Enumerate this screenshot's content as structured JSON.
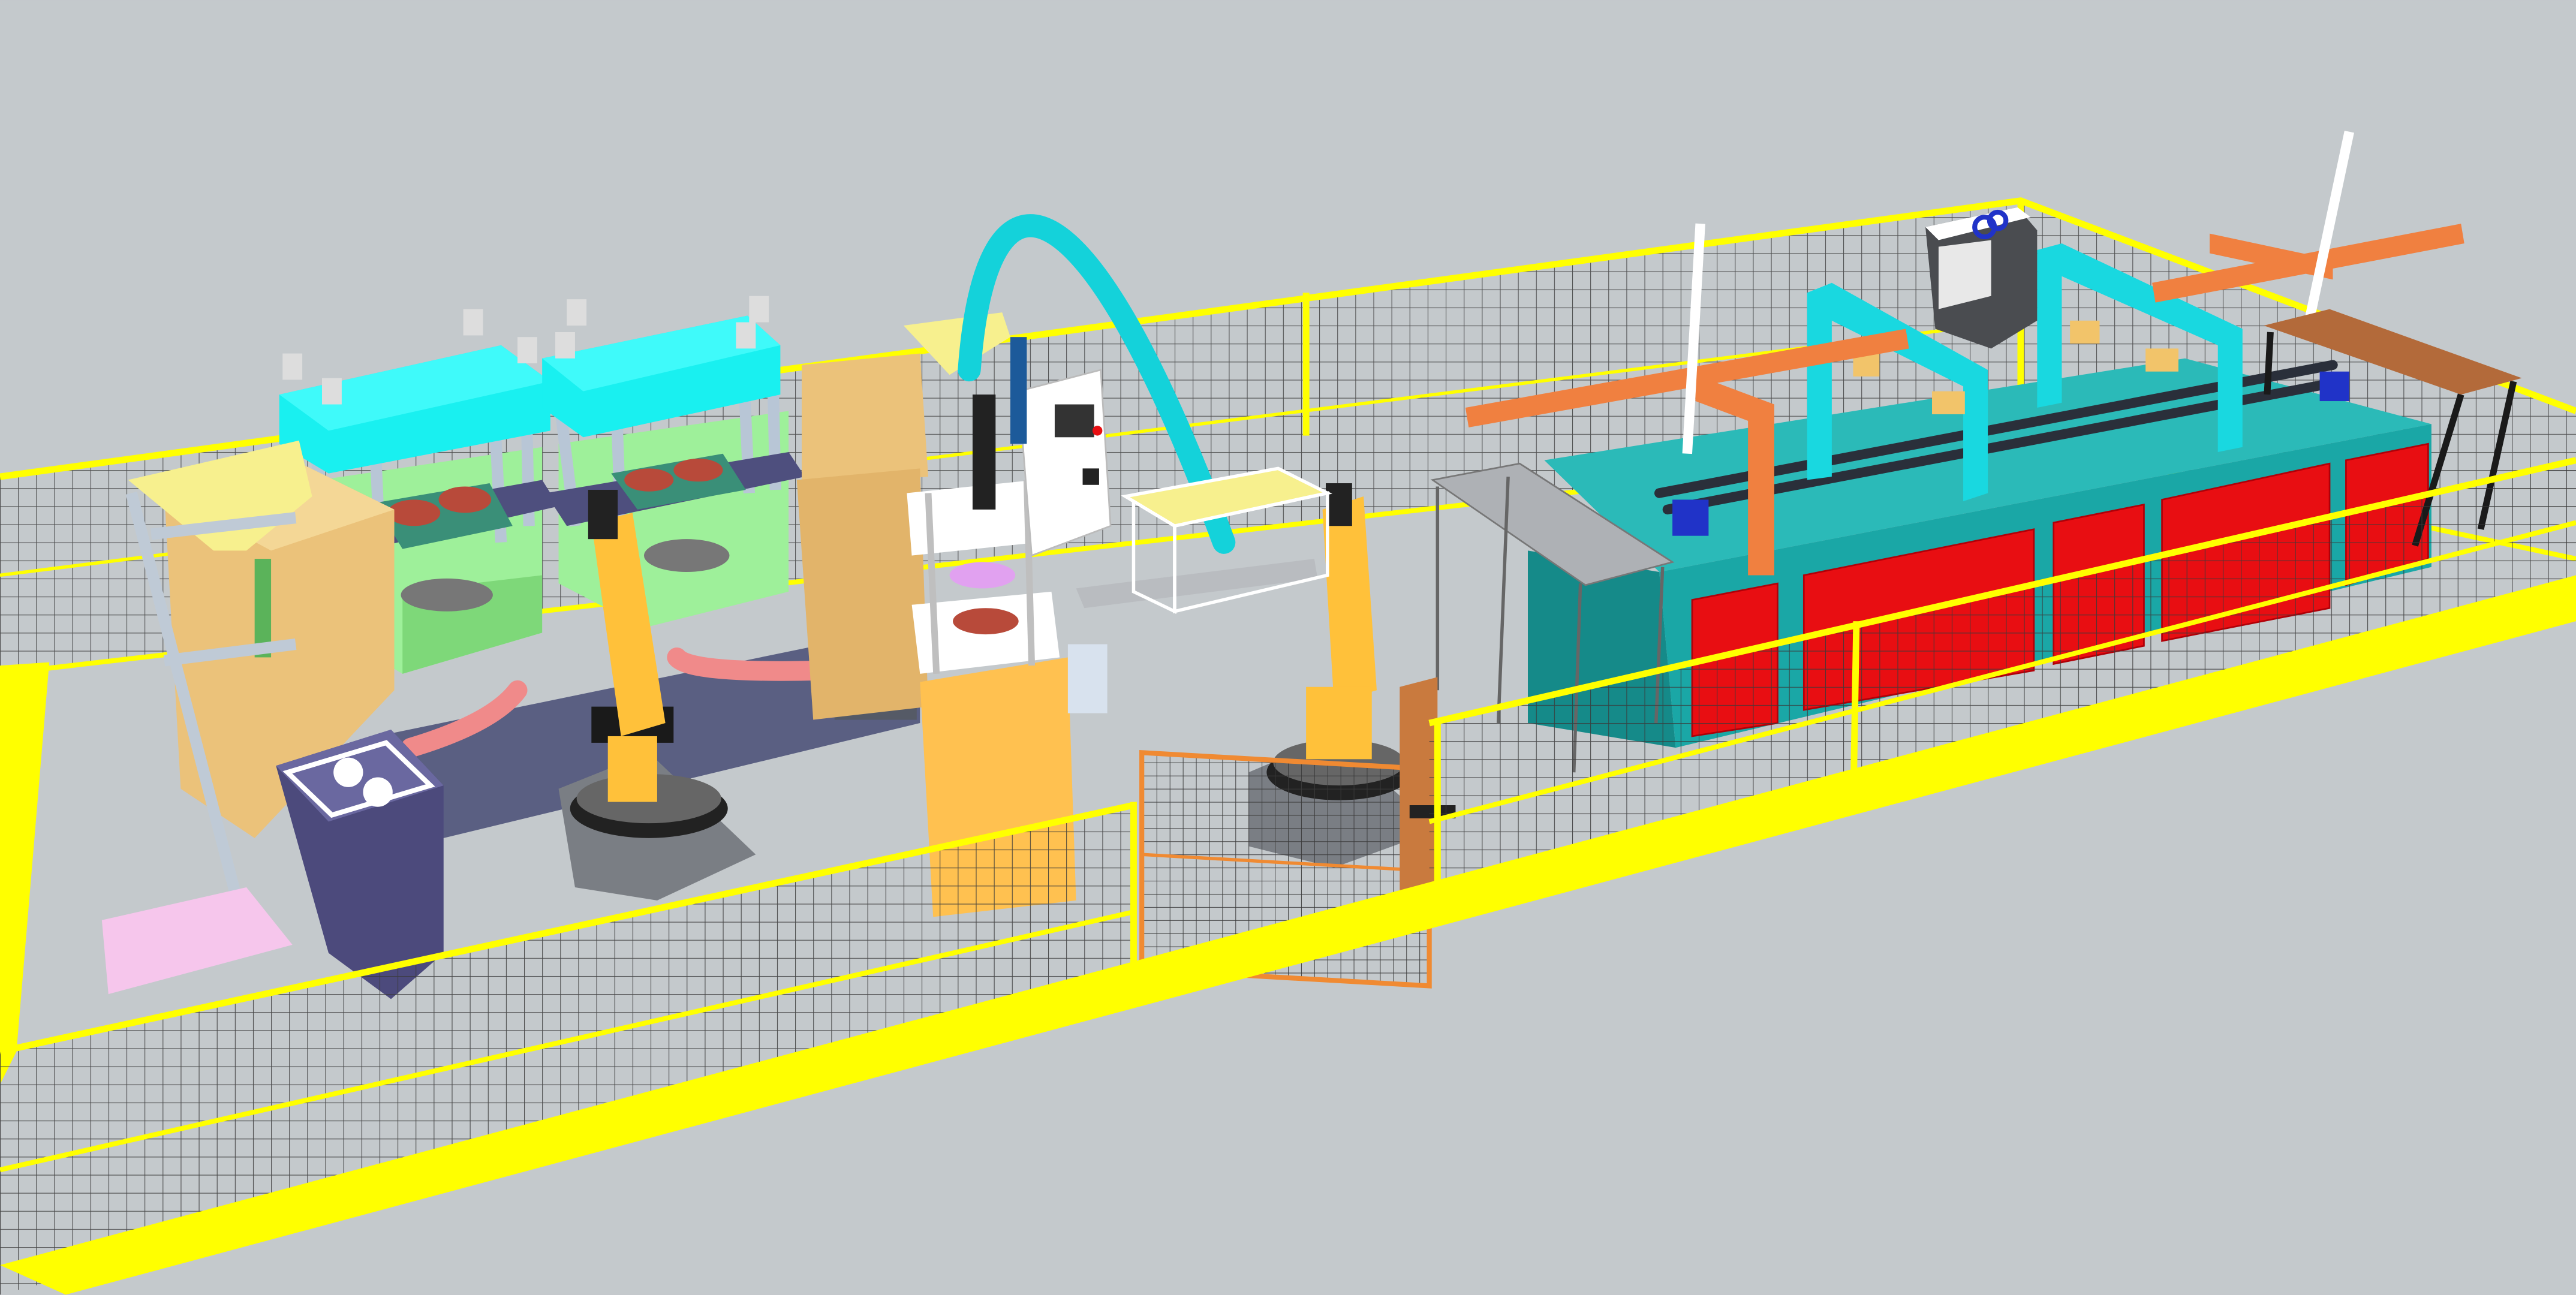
{
  "scene": {
    "type": "3d-factory-layout-viewport",
    "background_color": "#c4c9cc",
    "colors": {
      "safety_fence": "#ffff00",
      "floor_marking": "#ffff00",
      "press_top": "#19f0f0",
      "press_base": "#9ef09a",
      "robot_arm": "#ffc13a",
      "furnace_body": "#1aa7a6",
      "furnace_panels": "#e80e12",
      "overhead_beam": "#f08040",
      "duct": "#14d2da",
      "cardboard": "#ebc27a",
      "chute_cabinet": "#4c4a7c",
      "control_panel": "#ffffff",
      "pink_mat": "#f6c6ec",
      "gate_frame": "#f08a32"
    },
    "objects": [
      {
        "id": "press-left",
        "kind": "hydraulic-press",
        "icon": "press-icon"
      },
      {
        "id": "press-right",
        "kind": "hydraulic-press",
        "icon": "press-icon"
      },
      {
        "id": "robot-left",
        "kind": "industrial-robot",
        "icon": "robot-arm-icon"
      },
      {
        "id": "robot-right",
        "kind": "industrial-robot",
        "icon": "robot-arm-icon"
      },
      {
        "id": "furnace",
        "kind": "conveyor-furnace",
        "icon": "furnace-icon"
      },
      {
        "id": "control-cabinet",
        "kind": "control-panel",
        "icon": "control-panel-icon"
      },
      {
        "id": "cyan-duct",
        "kind": "exhaust-duct",
        "icon": "duct-icon"
      },
      {
        "id": "safety-gate",
        "kind": "fence-gate",
        "icon": "gate-icon"
      },
      {
        "id": "hopper",
        "kind": "funnel-hopper",
        "icon": "hopper-icon"
      },
      {
        "id": "chute-box",
        "kind": "parts-chute",
        "icon": "chute-icon"
      },
      {
        "id": "steel-table",
        "kind": "work-table",
        "icon": "table-icon"
      },
      {
        "id": "wood-table",
        "kind": "work-table",
        "icon": "table-icon"
      },
      {
        "id": "spool-unit",
        "kind": "dispenser",
        "icon": "spool-icon"
      }
    ]
  }
}
